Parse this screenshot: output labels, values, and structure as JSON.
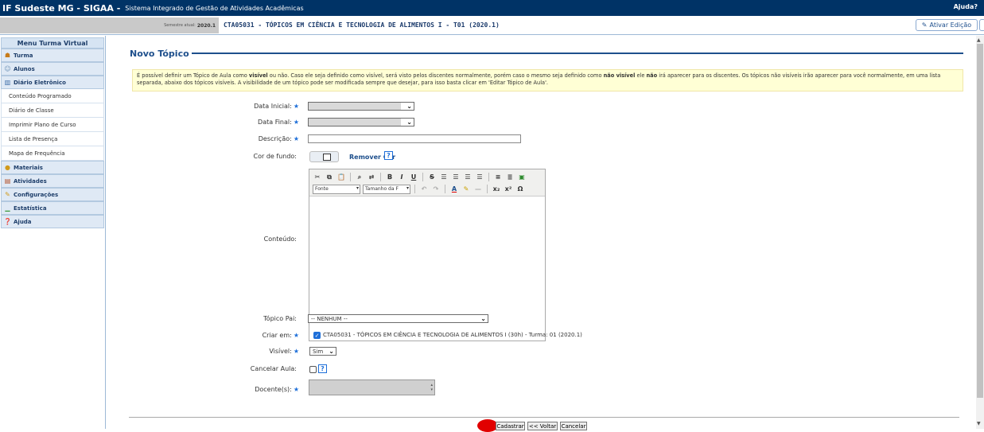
{
  "topbar": {
    "brand": "IF Sudeste MG - SIGAA -",
    "subtitle": "Sistema Integrado de Gestão de Atividades Acadêmicas",
    "help": "Ajuda?"
  },
  "infobar": {
    "semester_label": "Semestre atual:",
    "semester_value": "2020.1",
    "course": "CTA05031 - TÓPICOS EM CIÊNCIA E TECNOLOGIA DE ALIMENTOS I - T01 (2020.1)",
    "edit_button": "Ativar Edição"
  },
  "sidebar": {
    "title": "Menu Turma Virtual",
    "sections": {
      "turma": "Turma",
      "alunos": "Alunos",
      "diario": "Diário Eletrônico",
      "materiais": "Materiais",
      "atividades": "Atividades",
      "configuracoes": "Configurações",
      "estatistica": "Estatística",
      "ajuda": "Ajuda"
    },
    "diario_items": {
      "conteudo": "Conteúdo Programado",
      "diario_classe": "Diário de Classe",
      "imprimir": "Imprimir Plano de Curso",
      "lista": "Lista de Presença",
      "mapa": "Mapa de Frequência"
    }
  },
  "main": {
    "title": "Novo Tópico",
    "notice_part1": "É possível definir um Tópico de Aula como ",
    "notice_bold1": "visível",
    "notice_part2": " ou não. Caso ele seja definido como visível, será visto pelos discentes normalmente, porém caso o mesmo seja definido como ",
    "notice_bold2": "não visível",
    "notice_part3": " ele ",
    "notice_bold3": "não",
    "notice_part4": " irá aparecer para os discentes. Os tópicos não visíveis irão aparecer para você normalmente, em uma lista separada, abaixo dos tópicos visíveis. A visibilidade de um tópico pode ser modificada sempre que desejar, para isso basta clicar em 'Editar Tópico de Aula'."
  },
  "form": {
    "data_inicial_label": "Data Inicial:",
    "data_final_label": "Data Final:",
    "descricao_label": "Descrição:",
    "cor_label": "Cor de fundo:",
    "remover_cor": "Remover Cor",
    "conteudo_label": "Conteúdo:",
    "topico_pai_label": "Tópico Pai:",
    "topico_pai_value": "-- NENHUM --",
    "criar_em_label": "Criar em:",
    "criar_em_value": "CTA05031 - TÓPICOS EM CIÊNCIA E TECNOLOGIA DE ALIMENTOS I (30h) - Turma: 01 (2020.1)",
    "visivel_label": "Visível:",
    "visivel_value": "Sim",
    "cancelar_aula_label": "Cancelar Aula:",
    "docentes_label": "Docente(s):",
    "required_mark": "★",
    "help_mark": "?"
  },
  "editor": {
    "font_dropdown": "Fonte",
    "size_dropdown": "Tamanho da F"
  },
  "buttons": {
    "cadastrar": "Cadastrar",
    "voltar": "<< Voltar",
    "cancelar": "Cancelar"
  },
  "colors": {
    "header_bg": "#003366",
    "accent": "#1e4f8c",
    "notice_bg": "#ffffd5"
  }
}
